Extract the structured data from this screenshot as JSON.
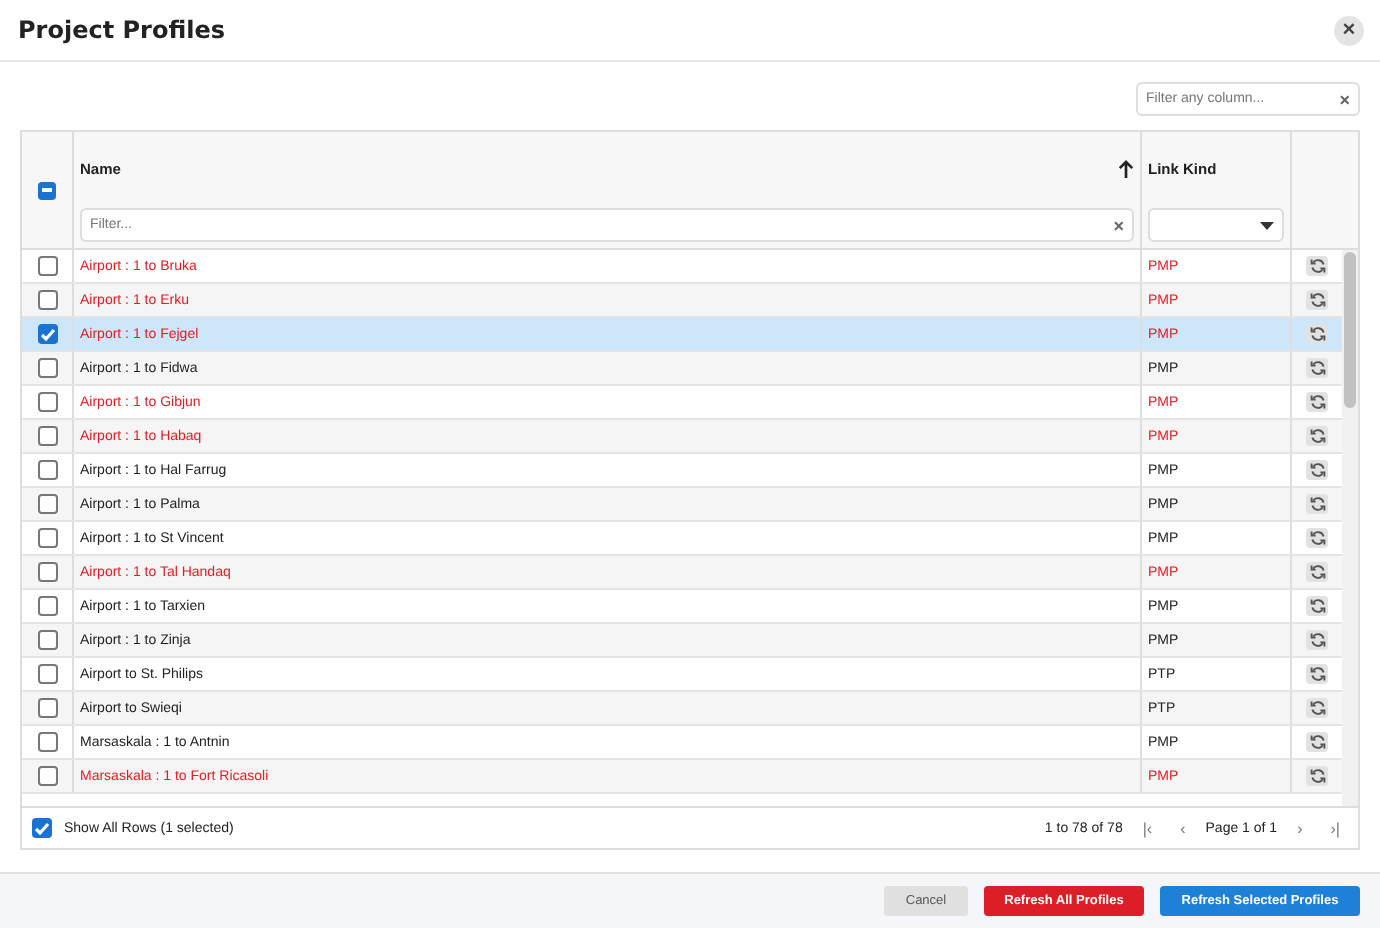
{
  "window": {
    "title": "Project Profiles",
    "close": "×"
  },
  "global_filter": {
    "placeholder": "Filter any column...",
    "clear": "×"
  },
  "table": {
    "header_partial": true,
    "columns": [
      {
        "label": "Name",
        "sort_ascending": true,
        "filter": {
          "kind": "text",
          "placeholder": "Filter...",
          "clear": "×"
        }
      },
      {
        "label": "Link Kind",
        "filter": {
          "kind": "select"
        }
      }
    ],
    "rows": [
      {
        "name": "Airport : 1 to Bruka",
        "link_kind": "PMP",
        "alert": true,
        "selected": false
      },
      {
        "name": "Airport : 1 to Erku",
        "link_kind": "PMP",
        "alert": true,
        "selected": false
      },
      {
        "name": "Airport : 1 to Fejgel",
        "link_kind": "PMP",
        "alert": true,
        "selected": true
      },
      {
        "name": "Airport : 1 to Fidwa",
        "link_kind": "PMP",
        "alert": false,
        "selected": false
      },
      {
        "name": "Airport : 1 to Gibjun",
        "link_kind": "PMP",
        "alert": true,
        "selected": false
      },
      {
        "name": "Airport : 1 to Habaq",
        "link_kind": "PMP",
        "alert": true,
        "selected": false
      },
      {
        "name": "Airport : 1 to Hal Farrug",
        "link_kind": "PMP",
        "alert": false,
        "selected": false
      },
      {
        "name": "Airport : 1 to Palma",
        "link_kind": "PMP",
        "alert": false,
        "selected": false
      },
      {
        "name": "Airport : 1 to St Vincent",
        "link_kind": "PMP",
        "alert": false,
        "selected": false
      },
      {
        "name": "Airport : 1 to Tal Handaq",
        "link_kind": "PMP",
        "alert": true,
        "selected": false
      },
      {
        "name": "Airport : 1 to Tarxien",
        "link_kind": "PMP",
        "alert": false,
        "selected": false
      },
      {
        "name": "Airport : 1 to Zinja",
        "link_kind": "PMP",
        "alert": false,
        "selected": false
      },
      {
        "name": "Airport to St. Philips",
        "link_kind": "PTP",
        "alert": false,
        "selected": false
      },
      {
        "name": "Airport to Swieqi",
        "link_kind": "PTP",
        "alert": false,
        "selected": false
      },
      {
        "name": "Marsaskala : 1 to Antnin",
        "link_kind": "PMP",
        "alert": false,
        "selected": false
      },
      {
        "name": "Marsaskala : 1 to Fort Ricasoli",
        "link_kind": "PMP",
        "alert": true,
        "selected": false
      }
    ],
    "footer": {
      "show_all": {
        "label": "Show All Rows (1 selected)",
        "checked": true
      },
      "range": "1 to 78 of 78",
      "page": "Page 1 of 1",
      "first": "|‹",
      "prev": "‹",
      "next": "›",
      "last": "›|"
    }
  },
  "buttons": [
    {
      "kind": "cancel",
      "label": "Cancel"
    },
    {
      "kind": "danger",
      "label": "Refresh All Profiles"
    },
    {
      "kind": "primary",
      "label": "Refresh Selected Profiles"
    }
  ]
}
